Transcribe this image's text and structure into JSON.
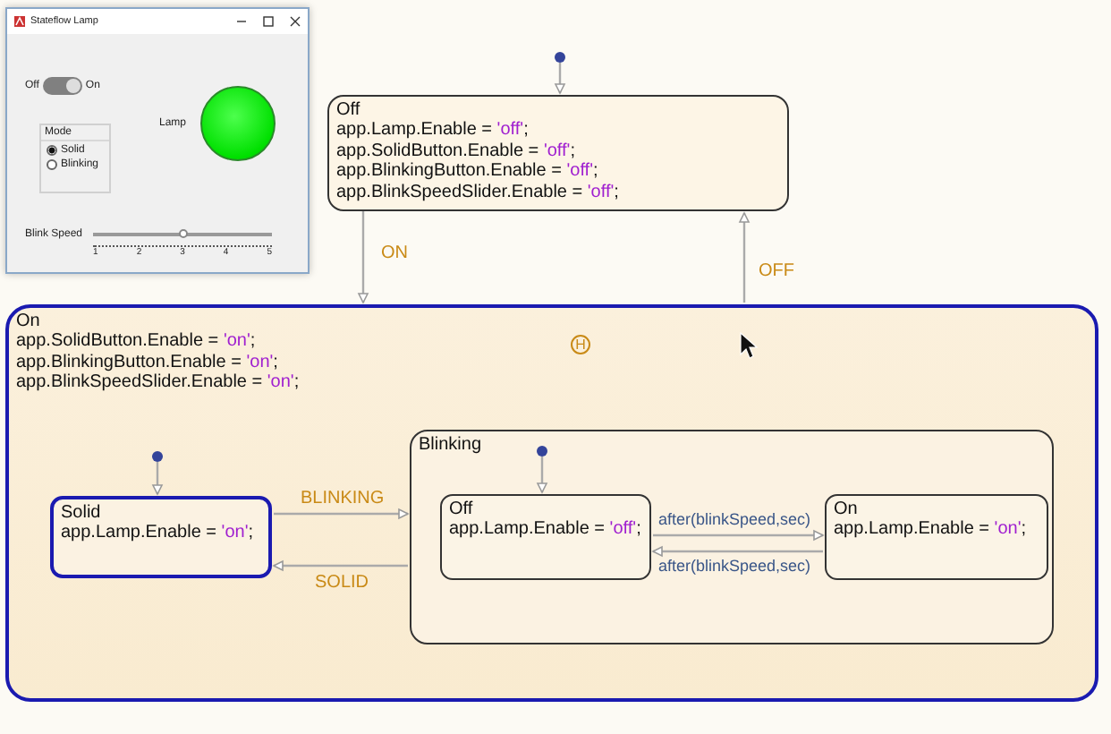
{
  "app_window": {
    "title": "Stateflow Lamp",
    "switch": {
      "off_label": "Off",
      "on_label": "On",
      "on": true
    },
    "lamp": {
      "label": "Lamp",
      "lit": true
    },
    "mode": {
      "title": "Mode",
      "options": [
        {
          "label": "Solid",
          "selected": true
        },
        {
          "label": "Blinking",
          "selected": false
        }
      ]
    },
    "slider": {
      "label": "Blink Speed",
      "level": 0.5,
      "ticks": [
        "1",
        "2",
        "3",
        "4",
        "5"
      ]
    }
  },
  "states": [
    {
      "name": "Off",
      "active": false,
      "actions": [
        {
          "code": "app.Lamp.Enable = ",
          "literal": "'off'",
          "end": ";"
        },
        {
          "code": "app.SolidButton.Enable = ",
          "literal": "'off'",
          "end": ";"
        },
        {
          "code": "app.BlinkingButton.Enable = ",
          "literal": "'off'",
          "end": ";"
        },
        {
          "code": "app.BlinkSpeedSlider.Enable = ",
          "literal": "'off'",
          "end": ";"
        }
      ]
    },
    {
      "name": "On",
      "active": true,
      "history_junction": "H",
      "actions": [
        {
          "code": "app.SolidButton.Enable = ",
          "literal": "'on'",
          "end": ";"
        },
        {
          "code": "app.BlinkingButton.Enable = ",
          "literal": "'on'",
          "end": ";"
        },
        {
          "code": "app.BlinkSpeedSlider.Enable = ",
          "literal": "'on'",
          "end": ";"
        }
      ],
      "children": [
        {
          "name": "Solid",
          "active": true,
          "actions": [
            {
              "code": "app.Lamp.Enable = ",
              "literal": "'on'",
              "end": ";"
            }
          ]
        },
        {
          "name": "Blinking",
          "active": false,
          "children": [
            {
              "name": "Off",
              "active": false,
              "actions": [
                {
                  "code": "app.Lamp.Enable = ",
                  "literal": "'off'",
                  "end": ";"
                }
              ]
            },
            {
              "name": "On",
              "active": false,
              "actions": [
                {
                  "code": "app.Lamp.Enable = ",
                  "literal": "'on'",
                  "end": ";"
                }
              ]
            }
          ]
        }
      ]
    }
  ],
  "transitions": [
    {
      "label": "ON",
      "kind": "event"
    },
    {
      "label": "OFF",
      "kind": "event"
    },
    {
      "label": "BLINKING",
      "kind": "event"
    },
    {
      "label": "SOLID",
      "kind": "event"
    },
    {
      "label": "after(blinkSpeed,sec)",
      "kind": "temporal"
    },
    {
      "label": "after(blinkSpeed,sec)",
      "kind": "temporal"
    }
  ]
}
